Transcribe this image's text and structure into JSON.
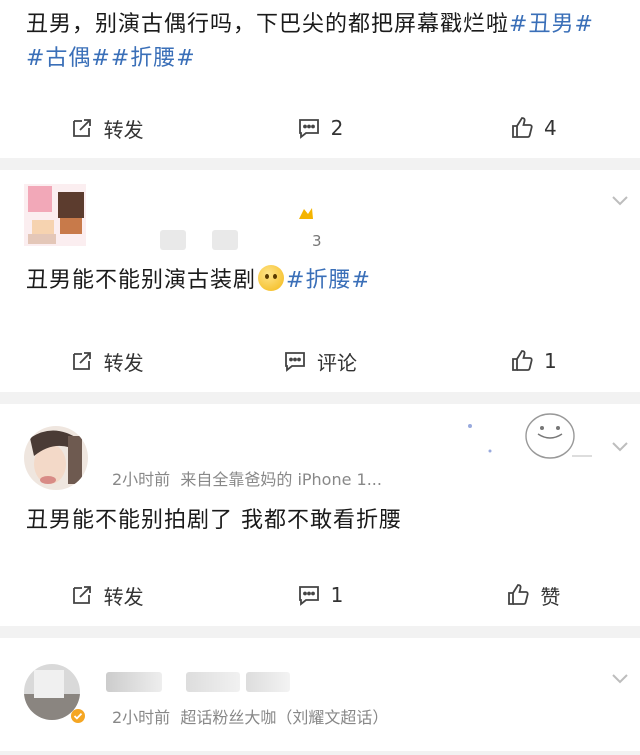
{
  "post1": {
    "content_prefix": "丑男，别演古偶行吗，下巴尖的都把屏幕戳烂啦",
    "tags": [
      "#丑男#",
      "#古偶#",
      "#折腰#"
    ],
    "actions": {
      "repost": "转发",
      "comment": "2",
      "like": "4"
    }
  },
  "post2": {
    "count": "3",
    "content": "丑男能不能别演古装剧",
    "tag": "#折腰#",
    "actions": {
      "repost": "转发",
      "comment": "评论",
      "like": "1"
    }
  },
  "post3": {
    "meta": "2小时前  来自全靠爸妈的 iPhone 1...",
    "content": "丑男能不能别拍剧了 我都不敢看折腰",
    "actions": {
      "repost": "转发",
      "comment": "1",
      "like": "赞"
    }
  },
  "post4": {
    "meta": "2小时前  超话粉丝大咖（刘耀文超话）"
  },
  "colors": {
    "tag": "#3a6fb8",
    "background": "#f2f2f2",
    "text": "#1a1a1a"
  }
}
